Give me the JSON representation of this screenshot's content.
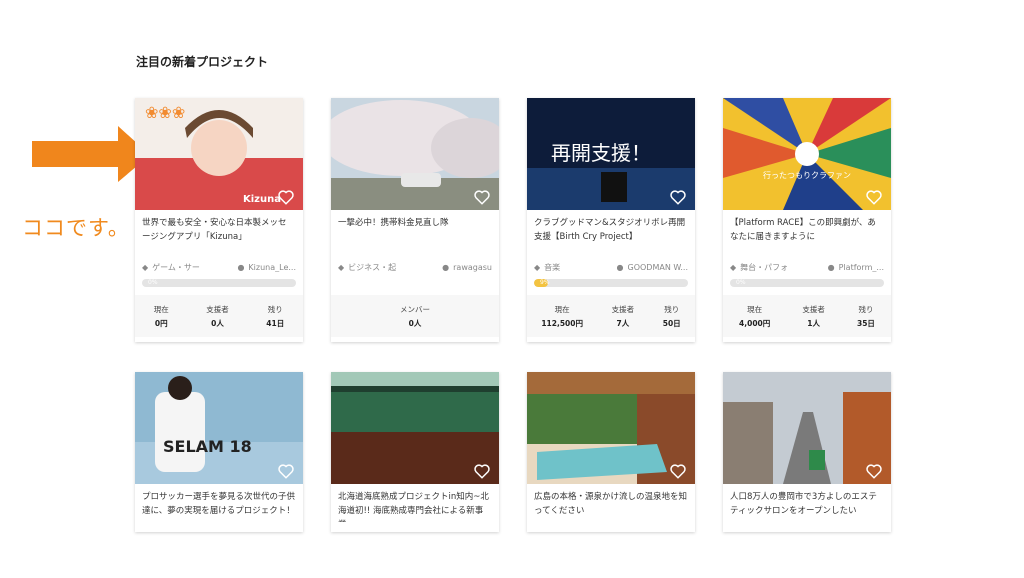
{
  "section_title": "注目の新着プロジェクト",
  "annotation": {
    "text": "ココです。",
    "color": "#f08a1e"
  },
  "cards": [
    {
      "title": "世界で最も安全・安心な日本製メッセージングアプリ「Kizuna」",
      "thumb_text": "Kizuna",
      "category": "ゲーム・サー",
      "user": "Kizuna_Le...",
      "progress_label": "0%",
      "progress": 0,
      "stats": [
        {
          "label": "現在",
          "value": "0円"
        },
        {
          "label": "支援者",
          "value": "0人"
        },
        {
          "label": "残り",
          "value": "41日"
        }
      ]
    },
    {
      "title": "一撃必中！携帯料金見直し隊",
      "thumb_text": "",
      "category": "ビジネス・起",
      "user": "rawagasu",
      "stats": [
        {
          "label": "メンバー",
          "value": "0人"
        }
      ]
    },
    {
      "title": "クラブグッドマン&スタジオリボレ再開支援【Birth Cry Project】",
      "thumb_text": "再開支援！",
      "category": "音楽",
      "user": "GOODMAN W...",
      "progress_label": "9%",
      "progress": 9,
      "stats": [
        {
          "label": "現在",
          "value": "112,500円"
        },
        {
          "label": "支援者",
          "value": "7人"
        },
        {
          "label": "残り",
          "value": "50日"
        }
      ]
    },
    {
      "title": "【Platform RACE】この即興劇が、あなたに届きますように",
      "thumb_text": "行ったつもりクラファン",
      "category": "舞台・パフォ",
      "user": "Platform_...",
      "progress_label": "0%",
      "progress": 0,
      "stats": [
        {
          "label": "現在",
          "value": "4,000円"
        },
        {
          "label": "支援者",
          "value": "1人"
        },
        {
          "label": "残り",
          "value": "35日"
        }
      ]
    },
    {
      "title": "プロサッカー選手を夢見る次世代の子供達に、夢の実現を届けるプロジェクト！",
      "thumb_text": "SELAM 18"
    },
    {
      "title": "北海道海底熟成プロジェクトin知内~北海道初!! 海底熟成専門会社による新事業",
      "thumb_text": ""
    },
    {
      "title": "広島の本格・源泉かけ流しの温泉地を知ってください",
      "thumb_text": ""
    },
    {
      "title": "人口8万人の豊岡市で3方よしのエステティックサロンをオープンしたい",
      "thumb_text": ""
    }
  ]
}
